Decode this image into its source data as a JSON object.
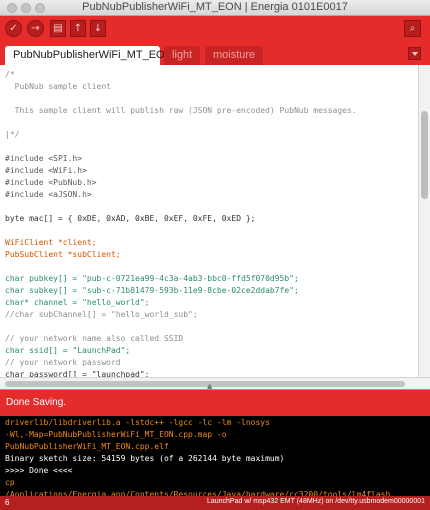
{
  "window": {
    "title": "PubNubPublisherWiFi_MT_EON | Energia 0101E0017"
  },
  "toolbar": {
    "verify_icon": "checkmark-icon",
    "upload_icon": "arrow-right-icon",
    "new_icon": "new-file-icon",
    "open_icon": "open-arrow-up-icon",
    "save_icon": "save-arrow-down-icon",
    "serial_icon": "magnifier-icon",
    "verify_glyph": "✓",
    "upload_glyph": "→",
    "new_glyph": "▤",
    "open_glyph": "↑",
    "save_glyph": "↓",
    "serial_glyph": "⌕"
  },
  "tabs": [
    {
      "label": "PubNubPublisherWiFi_MT_EON",
      "active": true
    },
    {
      "label": "light",
      "active": false
    },
    {
      "label": "moisture",
      "active": false
    }
  ],
  "editor": {
    "lines": [
      {
        "text": "/*",
        "color": "#8e8e8e"
      },
      {
        "text": "  PubNub sample client",
        "color": "#8e8e8e"
      },
      {
        "text": "",
        "color": "#8e8e8e"
      },
      {
        "text": "  This sample client will publish raw (JSON pre-encoded) PubNub messages.",
        "color": "#8e8e8e"
      },
      {
        "text": "",
        "color": "#8e8e8e"
      },
      {
        "text": "|*/",
        "color": "#8e8e8e"
      },
      {
        "text": "",
        "color": "#333333"
      },
      {
        "text": "#include <SPI.h>",
        "color": "#5a5a5a"
      },
      {
        "text": "#include <WiFi.h>",
        "color": "#5a5a5a"
      },
      {
        "text": "#include <PubNub.h>",
        "color": "#5a5a5a"
      },
      {
        "text": "#include <aJSON.h>",
        "color": "#5a5a5a"
      },
      {
        "text": "",
        "color": "#333333"
      },
      {
        "text": "byte mac[] = { 0xDE, 0xAD, 0xBE, 0xEF, 0xFE, 0xED };",
        "color": "#333333"
      },
      {
        "text": "",
        "color": "#333333"
      },
      {
        "text": "WiFiClient *client;",
        "color": "#d35400"
      },
      {
        "text": "PubSubClient *subClient;",
        "color": "#d35400"
      },
      {
        "text": "",
        "color": "#333333"
      },
      {
        "text": "char pubkey[] = \"pub-c-0721ea99-4c3a-4ab3-bbc0-ffd5f070d95b\";",
        "color": "#2a8c6a"
      },
      {
        "text": "char subkey[] = \"sub-c-71b81479-593b-11e9-8cbe-02ce2ddab7fe\";",
        "color": "#2a8c6a"
      },
      {
        "text": "char* channel = \"hello_world\";",
        "color": "#2a8c6a"
      },
      {
        "text": "//char subChannel[] = \"hello_world_sub\";",
        "color": "#8e8e8e"
      },
      {
        "text": "",
        "color": "#333333"
      },
      {
        "text": "// your network name also called SSID",
        "color": "#8e8e8e"
      },
      {
        "text": "char ssid[] = \"LaunchPad\";",
        "color": "#2a8c6a"
      },
      {
        "text": "// your network password",
        "color": "#8e8e8e"
      },
      {
        "text": "char password[] = \"launchpad\";",
        "color": "#333333"
      }
    ]
  },
  "status": {
    "message": "Done Saving."
  },
  "console": {
    "lines": [
      {
        "text": "driverlib/libdriverlib.a -lstdc++ -lgcc -lc -lm -lnosys",
        "color": "#f08a1c"
      },
      {
        "text": "-Wl,-Map=PubNubPublisherWiFi_MT_EON.cpp.map -o",
        "color": "#f08a1c"
      },
      {
        "text": "PubNubPublisherWiFi_MT_EON.cpp.elf",
        "color": "#f08a1c"
      },
      {
        "text": "Binary sketch size: 54159 bytes (of a 262144 byte maximum)",
        "color": "#ffffff"
      },
      {
        "text": ">>>> Done <<<<",
        "color": "#ffffff"
      },
      {
        "text": "cp",
        "color": "#f08a1c"
      },
      {
        "text": "/Applications/Energia.app/Contents/Resources/Java/hardware/cc3200/tools/lm4flash",
        "color": "#f08a1c"
      }
    ]
  },
  "footer": {
    "line_number": "6",
    "board_info": "LaunchPad w/ msp432 EMT (48MHz) on /dev/tty.usbmodem00000001"
  }
}
